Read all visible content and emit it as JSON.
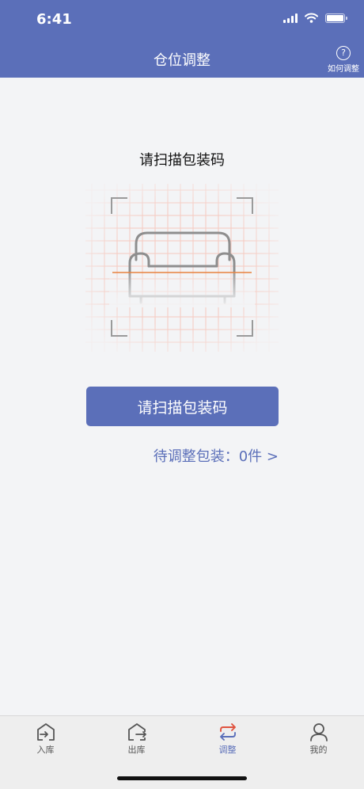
{
  "status_bar": {
    "time": "6:41"
  },
  "header": {
    "title": "仓位调整",
    "help_symbol": "?",
    "help_label": "如何调整"
  },
  "scan": {
    "prompt": "请扫描包装码",
    "button_label": "请扫描包装码",
    "pending_text": "待调整包装：0件 >"
  },
  "tabs": [
    {
      "label": "入库",
      "icon": "inbound-icon",
      "active": false
    },
    {
      "label": "出库",
      "icon": "outbound-icon",
      "active": false
    },
    {
      "label": "调整",
      "icon": "adjust-icon",
      "active": true
    },
    {
      "label": "我的",
      "icon": "profile-icon",
      "active": false
    }
  ],
  "colors": {
    "primary": "#5b6fb9",
    "background": "#f3f4f6",
    "adjust_red": "#e0533f",
    "grid": "#f6c9bf",
    "scan_line": "#e8823e"
  }
}
